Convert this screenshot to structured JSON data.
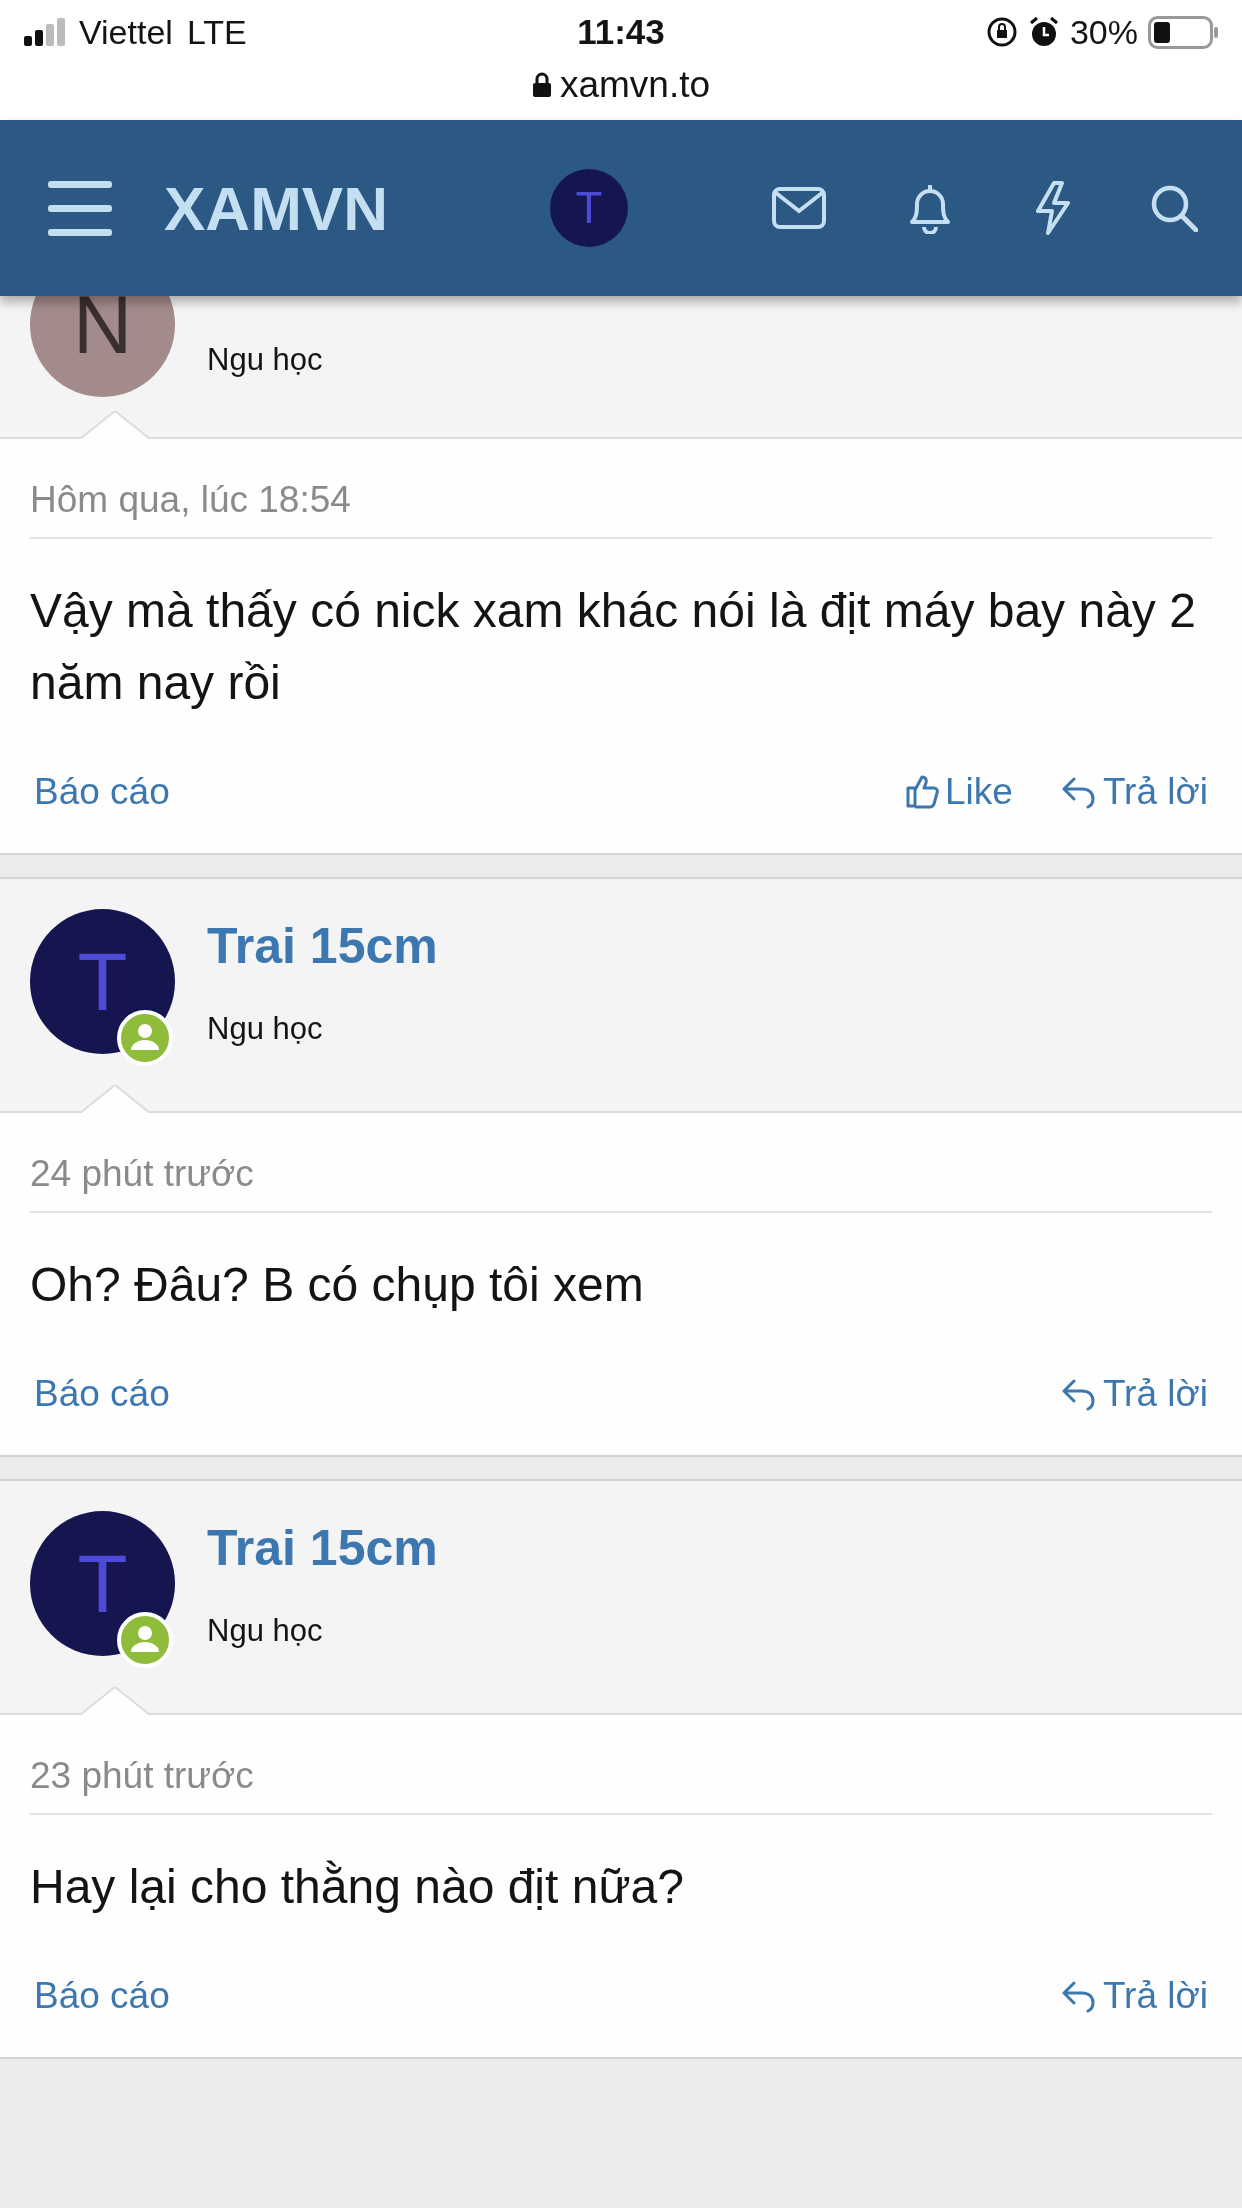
{
  "status_bar": {
    "carrier": "Viettel",
    "network": "LTE",
    "time": "11:43",
    "battery": "30%"
  },
  "address_bar": {
    "url": "xamvn.to"
  },
  "header": {
    "logo": "XAMVN",
    "avatar_letter": "T"
  },
  "posts": [
    {
      "avatar_letter": "N",
      "color": "#a48b8b",
      "online": false,
      "user_title": "Ngu học",
      "date": "Hôm qua, lúc 18:54",
      "message": "Vậy mà thấy có nick xam khác nói là địt máy bay này 2 năm nay rồi",
      "report": "Báo cáo",
      "actions": [
        {
          "kind": "like",
          "label": "Like"
        },
        {
          "kind": "reply",
          "label": "Trả lời"
        }
      ]
    },
    {
      "avatar_letter": "T",
      "color": "#15154f",
      "online": true,
      "username": "Trai 15cm",
      "user_title": "Ngu học",
      "date": "24 phút trước",
      "message": "Oh? Đâu? B có chụp tôi xem",
      "report": "Báo cáo",
      "actions": [
        {
          "kind": "reply",
          "label": "Trả lời"
        }
      ]
    },
    {
      "avatar_letter": "T",
      "color": "#15154f",
      "online": true,
      "username": "Trai 15cm",
      "user_title": "Ngu học",
      "date": "23 phút trước",
      "message": "Hay lại cho thằng nào địt nữa?",
      "report": "Báo cáo",
      "actions": [
        {
          "kind": "reply",
          "label": "Trả lời"
        }
      ]
    }
  ]
}
